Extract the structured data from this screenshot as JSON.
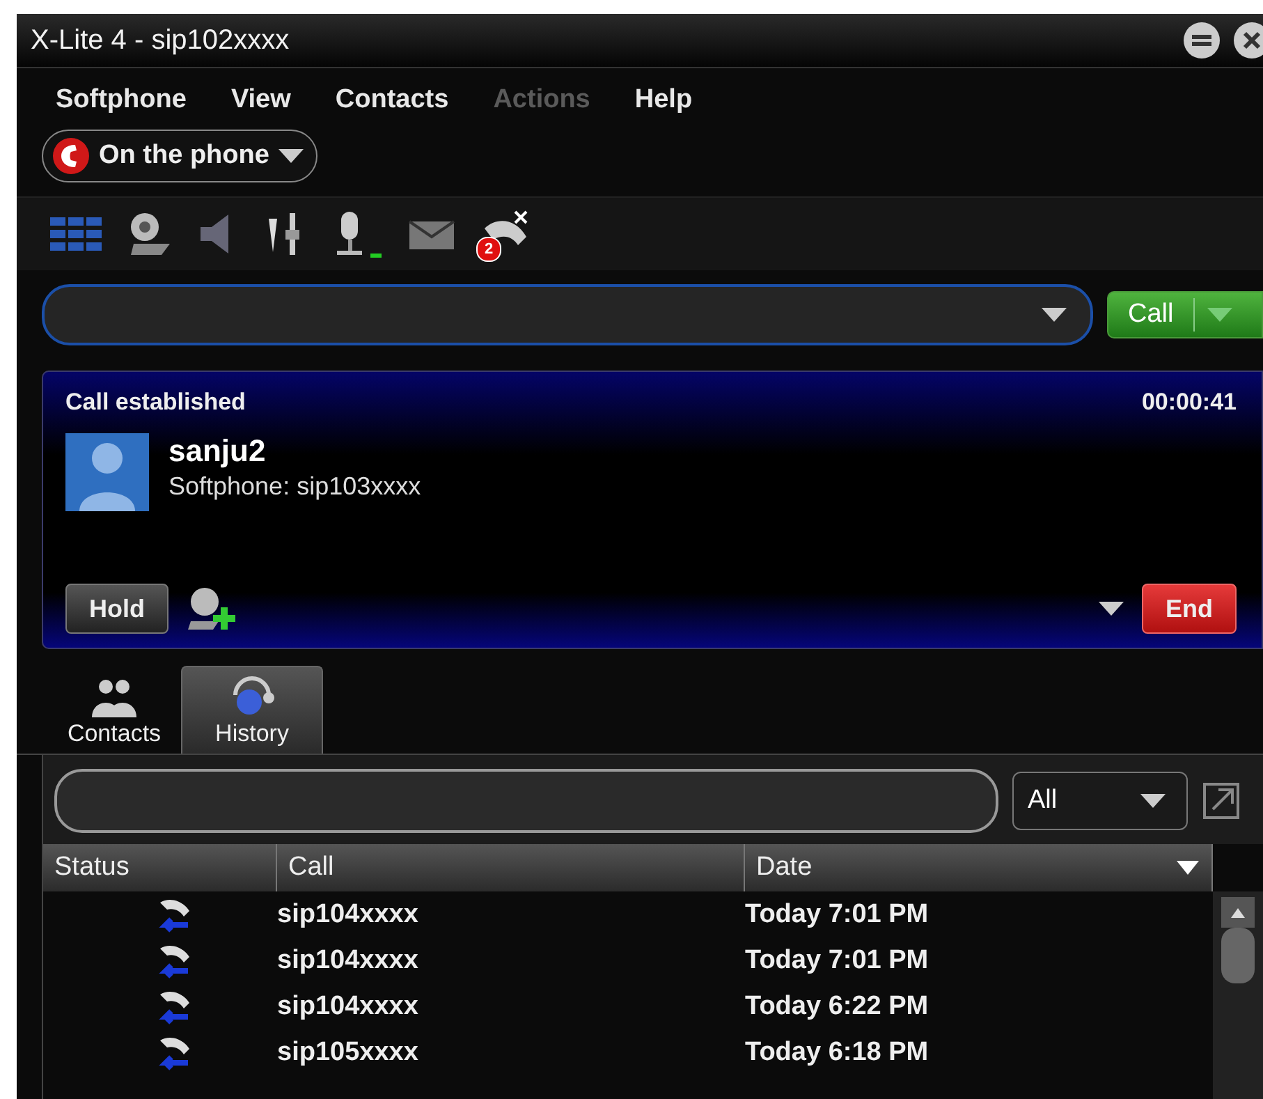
{
  "window": {
    "title": "X-Lite 4 - sip102xxxx"
  },
  "menu": [
    {
      "label": "Softphone",
      "disabled": false
    },
    {
      "label": "View",
      "disabled": false
    },
    {
      "label": "Contacts",
      "disabled": false
    },
    {
      "label": "Actions",
      "disabled": true
    },
    {
      "label": "Help",
      "disabled": false
    }
  ],
  "presence": {
    "label": "On the phone"
  },
  "toolbar": {
    "missed_calls_badge": "2"
  },
  "dial": {
    "call_button": "Call"
  },
  "call": {
    "status": "Call established",
    "timer": "00:00:41",
    "name": "sanju2",
    "detail": "Softphone: sip103xxxx",
    "hold_button": "Hold",
    "end_button": "End"
  },
  "tabs": [
    {
      "label": "Contacts",
      "selected": false
    },
    {
      "label": "History",
      "selected": true
    }
  ],
  "history": {
    "filter": "All",
    "columns": [
      "Status",
      "Call",
      "Date"
    ],
    "rows": [
      {
        "call": "sip104xxxx",
        "date": "Today 7:01 PM"
      },
      {
        "call": "sip104xxxx",
        "date": "Today 7:01 PM"
      },
      {
        "call": "sip104xxxx",
        "date": "Today 6:22 PM"
      },
      {
        "call": "sip105xxxx",
        "date": "Today 6:18 PM"
      }
    ]
  }
}
